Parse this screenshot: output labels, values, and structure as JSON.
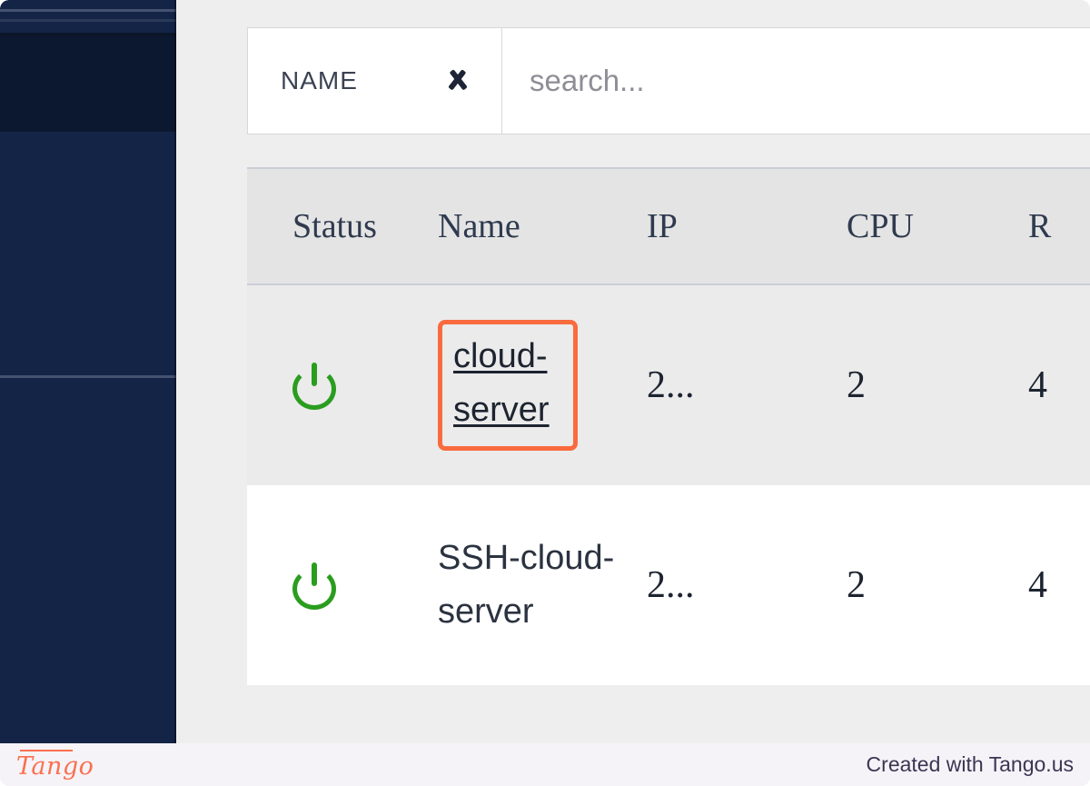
{
  "filter": {
    "dropdown_label": "NAME",
    "dropdown_icon": "chevron-down-icon",
    "search_value": "",
    "search_placeholder": "search..."
  },
  "table": {
    "headers": [
      "Status",
      "Name",
      "IP",
      "CPU",
      "R"
    ],
    "rows": [
      {
        "status_icon": "power-icon",
        "name": "cloud-server",
        "name_is_link": true,
        "highlighted": true,
        "ip": "2...",
        "cpu": "2",
        "ram": "4"
      },
      {
        "status_icon": "power-icon",
        "name": "SSH-cloud-server",
        "name_is_link": false,
        "highlighted": false,
        "ip": "2...",
        "cpu": "2",
        "ram": "4"
      }
    ]
  },
  "footer": {
    "logo": "Tango",
    "note": "Created with Tango.us"
  },
  "colors": {
    "sidebar": "#142447",
    "sidebar_dark": "#0c182f",
    "highlight": "#f96b3e",
    "status_green": "#2a9d1f",
    "panel_bg": "#efeeee",
    "header_bg": "#e4e4e4",
    "row_alt_bg": "#ebebeb",
    "footer_bg": "#f5f3f7"
  }
}
